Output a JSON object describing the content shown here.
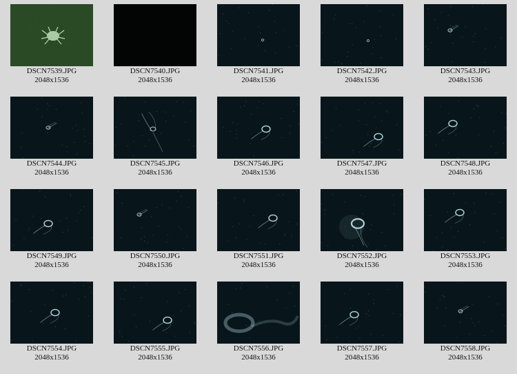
{
  "colors": {
    "background": "#d9d9d9",
    "text": "#111111",
    "water_dark": "#061014",
    "water_light": "#0f2228",
    "jelly": "#bfe3e8",
    "algae": "#2a4a26",
    "crab": "#b8d7b0"
  },
  "thumbnails": [
    {
      "filename": "DSCN7539.JPG",
      "dimensions": "2048x1536",
      "scene": "crab-on-green",
      "icon": "crab-icon"
    },
    {
      "filename": "DSCN7540.JPG",
      "dimensions": "2048x1536",
      "scene": "black",
      "icon": "empty-frame-icon"
    },
    {
      "filename": "DSCN7541.JPG",
      "dimensions": "2048x1536",
      "scene": "tiny-speck",
      "icon": "speck-icon"
    },
    {
      "filename": "DSCN7542.JPG",
      "dimensions": "2048x1536",
      "scene": "tiny-speck",
      "icon": "speck-icon"
    },
    {
      "filename": "DSCN7543.JPG",
      "dimensions": "2048x1536",
      "scene": "small-jelly",
      "icon": "jellyfish-icon"
    },
    {
      "filename": "DSCN7544.JPG",
      "dimensions": "2048x1536",
      "scene": "small-jelly",
      "icon": "jellyfish-icon"
    },
    {
      "filename": "DSCN7545.JPG",
      "dimensions": "2048x1536",
      "scene": "long-jelly",
      "icon": "jellyfish-icon"
    },
    {
      "filename": "DSCN7546.JPG",
      "dimensions": "2048x1536",
      "scene": "bell-jelly",
      "icon": "jellyfish-icon"
    },
    {
      "filename": "DSCN7547.JPG",
      "dimensions": "2048x1536",
      "scene": "bell-jelly",
      "icon": "jellyfish-icon"
    },
    {
      "filename": "DSCN7548.JPG",
      "dimensions": "2048x1536",
      "scene": "bell-jelly",
      "icon": "jellyfish-icon"
    },
    {
      "filename": "DSCN7549.JPG",
      "dimensions": "2048x1536",
      "scene": "bell-jelly",
      "icon": "jellyfish-icon"
    },
    {
      "filename": "DSCN7550.JPG",
      "dimensions": "2048x1536",
      "scene": "small-jelly",
      "icon": "jellyfish-icon"
    },
    {
      "filename": "DSCN7551.JPG",
      "dimensions": "2048x1536",
      "scene": "bell-jelly",
      "icon": "jellyfish-icon"
    },
    {
      "filename": "DSCN7552.JPG",
      "dimensions": "2048x1536",
      "scene": "large-jelly",
      "icon": "jellyfish-icon"
    },
    {
      "filename": "DSCN7553.JPG",
      "dimensions": "2048x1536",
      "scene": "bell-jelly",
      "icon": "jellyfish-icon"
    },
    {
      "filename": "DSCN7554.JPG",
      "dimensions": "2048x1536",
      "scene": "bell-jelly",
      "icon": "jellyfish-icon"
    },
    {
      "filename": "DSCN7555.JPG",
      "dimensions": "2048x1536",
      "scene": "bell-jelly",
      "icon": "jellyfish-icon"
    },
    {
      "filename": "DSCN7556.JPG",
      "dimensions": "2048x1536",
      "scene": "blurry-jelly",
      "icon": "jellyfish-icon"
    },
    {
      "filename": "DSCN7557.JPG",
      "dimensions": "2048x1536",
      "scene": "bell-jelly",
      "icon": "jellyfish-icon"
    },
    {
      "filename": "DSCN7558.JPG",
      "dimensions": "2048x1536",
      "scene": "small-jelly",
      "icon": "jellyfish-icon"
    }
  ]
}
